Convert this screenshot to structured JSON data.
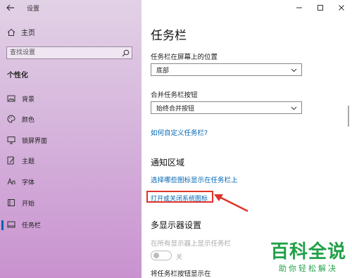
{
  "app": {
    "title": "设置"
  },
  "sidebar": {
    "home_label": "主页",
    "search_placeholder": "查找设置",
    "section": "个性化",
    "items": [
      {
        "label": "背景",
        "icon": "image-icon"
      },
      {
        "label": "颜色",
        "icon": "palette-icon"
      },
      {
        "label": "锁屏界面",
        "icon": "monitor-icon"
      },
      {
        "label": "主题",
        "icon": "brush-icon"
      },
      {
        "label": "字体",
        "icon": "font-icon"
      },
      {
        "label": "开始",
        "icon": "start-icon"
      },
      {
        "label": "任务栏",
        "icon": "taskbar-icon",
        "active": true
      }
    ]
  },
  "main": {
    "title": "任务栏",
    "location_label": "任务栏在屏幕上的位置",
    "location_value": "底部",
    "combine_label": "合并任务栏按钮",
    "combine_value": "始终合并按钮",
    "customize_link": "如何自定义任务栏?",
    "notify_heading": "通知区域",
    "notify_link1": "选择哪些图标显示在任务栏上",
    "notify_link2": "打开或关闭系统图标",
    "multi_heading": "多显示器设置",
    "multi_show_label": "在所有显示器上显示任务栏",
    "toggle_state": "关",
    "buttons_label": "将任务栏按钮显示在"
  },
  "watermark": {
    "big": "百科全说",
    "small": "助你轻松解决"
  },
  "colors": {
    "accent": "#0063b1",
    "link": "#0066b4",
    "highlight": "#e0332b",
    "watermark": "#21a048"
  }
}
